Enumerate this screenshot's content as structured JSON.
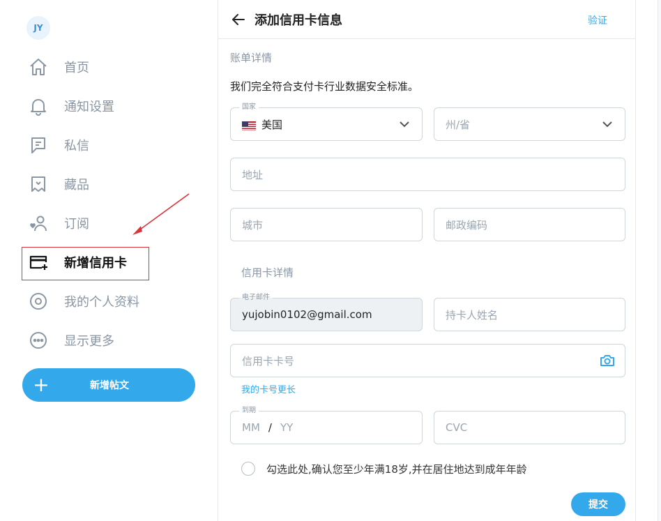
{
  "sidebar": {
    "avatar": "JY",
    "items": [
      {
        "label": "首页",
        "icon": "home-icon"
      },
      {
        "label": "通知设置",
        "icon": "bell-icon"
      },
      {
        "label": "私信",
        "icon": "message-icon"
      },
      {
        "label": "藏品",
        "icon": "collection-icon"
      },
      {
        "label": "订阅",
        "icon": "subscription-icon"
      },
      {
        "label": "新增信用卡",
        "icon": "credit-card-add-icon"
      },
      {
        "label": "我的个人资料",
        "icon": "profile-icon"
      },
      {
        "label": "显示更多",
        "icon": "more-icon"
      }
    ],
    "new_post": "新增帖文"
  },
  "header": {
    "title": "添加信用卡信息",
    "verify": "验证"
  },
  "billing": {
    "heading": "账单详情",
    "note": "我们完全符合支付卡行业数据安全标准。",
    "country_label": "国家",
    "country_value": "美国",
    "state_placeholder": "州/省",
    "address_placeholder": "地址",
    "city_placeholder": "城市",
    "zip_placeholder": "邮政编码"
  },
  "card": {
    "heading": "信用卡详情",
    "email_label": "电子邮件",
    "email_value": "yujobin0102@gmail.com",
    "holder_placeholder": "持卡人姓名",
    "number_placeholder": "信用卡卡号",
    "longer_link": "我的卡号更长",
    "expiry_label": "到期",
    "expiry_mm": "MM",
    "expiry_sep": "/",
    "expiry_yy": "YY",
    "cvc_placeholder": "CVC"
  },
  "consent": "勾选此处,确认您至少年满18岁,并在居住地达到成年年龄",
  "submit": "提交",
  "colors": {
    "accent": "#33a9ec",
    "annotation": "#d9333b"
  }
}
